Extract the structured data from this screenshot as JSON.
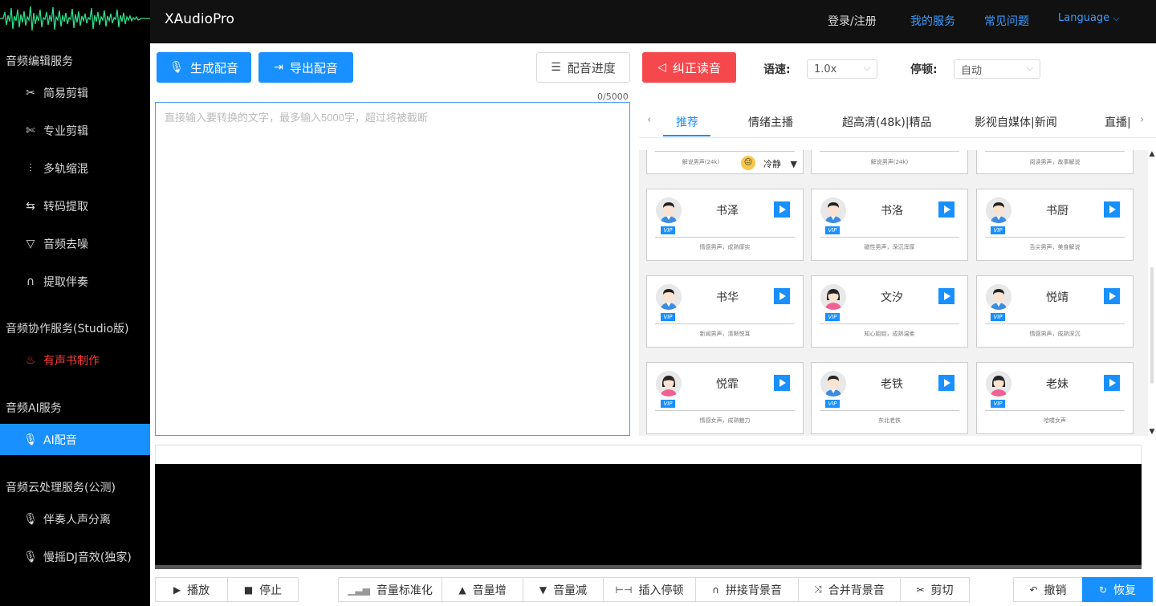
{
  "app": {
    "title": "XAudioPro"
  },
  "topnav": {
    "login": "登录/注册",
    "my_service": "我的服务",
    "faq": "常见问题",
    "language": "Language",
    "language_chevron": "⌵"
  },
  "sidebar": {
    "sections": [
      {
        "title": "音频编辑服务"
      },
      {
        "title": "音频协作服务(Studio版)"
      },
      {
        "title": "音频AI服务"
      },
      {
        "title": "音频云处理服务(公测)"
      }
    ],
    "items": [
      {
        "label": "简易剪辑",
        "icon": "scissors-icon"
      },
      {
        "label": "专业剪辑",
        "icon": "scissors-icon"
      },
      {
        "label": "多轨缩混",
        "icon": "sliders-icon"
      },
      {
        "label": "转码提取",
        "icon": "swap-icon"
      },
      {
        "label": "音频去噪",
        "icon": "filter-icon"
      },
      {
        "label": "提取伴奏",
        "icon": "headphones-icon"
      },
      {
        "label": "有声书制作",
        "icon": "fire-icon"
      },
      {
        "label": "AI配音",
        "icon": "microphone-icon"
      },
      {
        "label": "伴奏人声分离",
        "icon": "microphone-icon"
      },
      {
        "label": "慢摇DJ音效(独家)",
        "icon": "microphone-icon"
      }
    ]
  },
  "toolbar": {
    "generate": "生成配音",
    "export": "导出配音",
    "progress": "配音进度",
    "correct": "纠正读音",
    "speed_label": "语速:",
    "speed_value": "1.0x",
    "pause_label": "停顿:",
    "pause_value": "自动"
  },
  "editor": {
    "counter": "0/5000",
    "placeholder": "直接输入要转换的文字，最多输入5000字，超过将被截断"
  },
  "tabs": {
    "items": [
      "推荐",
      "情绪主播",
      "超高清(48k)|精品",
      "影视自媒体|新闻",
      "直播|"
    ],
    "active": 0,
    "prev": "‹",
    "next": "›"
  },
  "voices": {
    "partial_row": [
      {
        "desc": "解说男声(24k)",
        "mood": "冷静"
      },
      {
        "desc": "解说男声(24k)"
      },
      {
        "desc": "阅读男声，故事解说"
      }
    ],
    "cards": [
      {
        "name": "书泽",
        "desc": "情感男声，成熟厚实",
        "gender": "male",
        "vip": "VIP"
      },
      {
        "name": "书洛",
        "desc": "磁性男声，深沉浑厚",
        "gender": "male",
        "vip": "VIP"
      },
      {
        "name": "书厨",
        "desc": "舌尖男声，美食解说",
        "gender": "male",
        "vip": "VIP"
      },
      {
        "name": "书华",
        "desc": "新闻男声，清晰悦耳",
        "gender": "male",
        "vip": "VIP"
      },
      {
        "name": "文汐",
        "desc": "知心姐姐，成熟温柔",
        "gender": "female",
        "vip": "VIP"
      },
      {
        "name": "悦靖",
        "desc": "情感男声，成熟深沉",
        "gender": "male",
        "vip": "VIP"
      },
      {
        "name": "悦霏",
        "desc": "情感女声，成熟魅力",
        "gender": "female",
        "vip": "VIP"
      },
      {
        "name": "老铁",
        "desc": "东北老铁",
        "gender": "male",
        "vip": "VIP"
      },
      {
        "name": "老妹",
        "desc": "哈喽女声",
        "gender": "female",
        "vip": "VIP"
      }
    ]
  },
  "bottom_toolbar": {
    "play": "播放",
    "stop": "停止",
    "normalize": "音量标准化",
    "vol_up": "音量增",
    "vol_down": "音量减",
    "insert_pause": "插入停顿",
    "splice_bg": "拼接背景音",
    "merge_bg": "合并背景音",
    "cut": "剪切",
    "undo": "撤销",
    "redo": "恢复"
  },
  "colors": {
    "accent": "#1890ff",
    "danger": "#f5484d",
    "sidebar_bg": "#000000",
    "topbar_bg": "#111111"
  }
}
